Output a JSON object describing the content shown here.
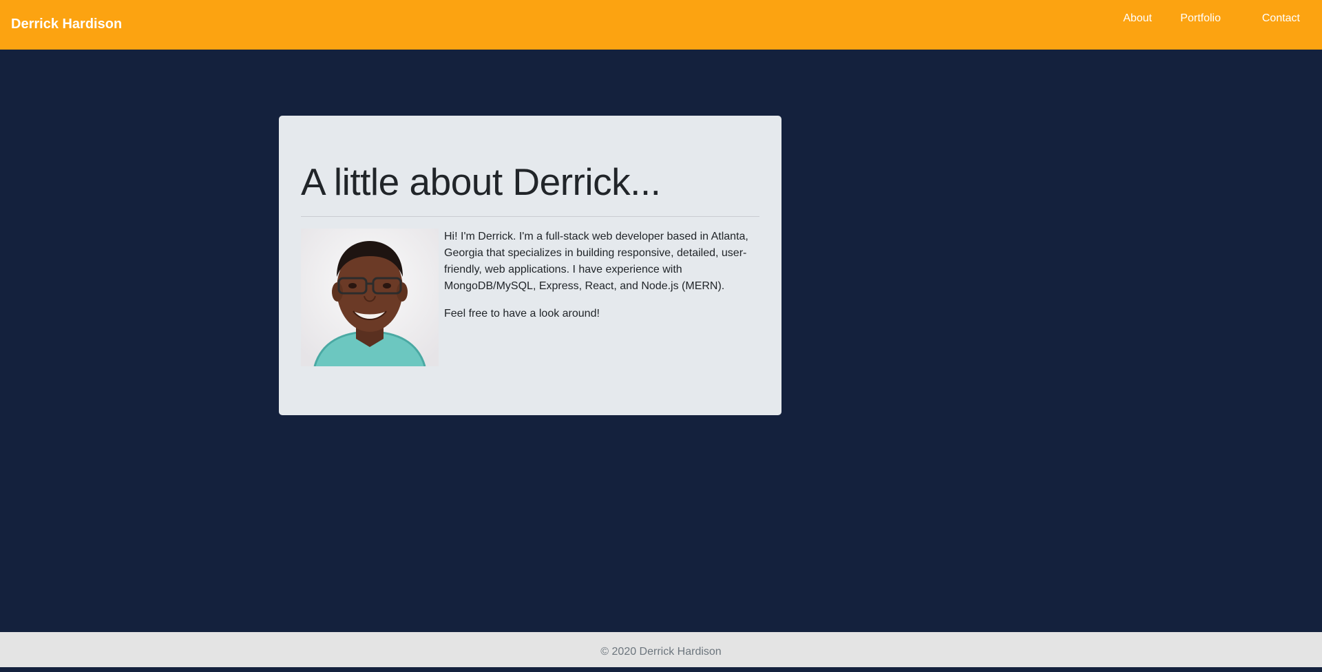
{
  "navbar": {
    "brand": "Derrick Hardison",
    "links": [
      {
        "label": "About"
      },
      {
        "label": "Portfolio"
      },
      {
        "label": "Contact"
      }
    ]
  },
  "about": {
    "heading": "A little about Derrick...",
    "paragraphs": [
      "Hi! I'm Derrick. I'm a full-stack web developer based in Atlanta, Georgia that specializes in building responsive, detailed, user-friendly, web applications. I have experience with MongoDB/MySQL, Express, React, and Node.js (MERN).",
      "Feel free to have a look around!"
    ]
  },
  "footer": {
    "text": "© 2020 Derrick Hardison"
  },
  "colors": {
    "navbar_bg": "#fca311",
    "page_bg": "#14213d",
    "card_bg": "#e5e9ed",
    "footer_bg": "#e4e4e4"
  }
}
